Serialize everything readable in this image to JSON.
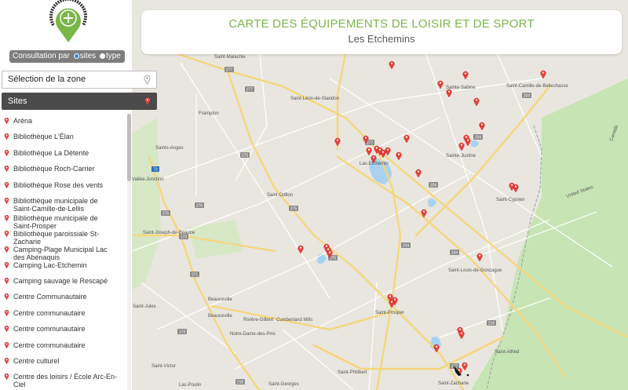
{
  "title": {
    "main": "CARTE DES ÉQUIPEMENTS DE LOISIR ET DE SPORT",
    "sub": "Les Etchemins"
  },
  "mode": {
    "label": "Consultation par",
    "option_sites": "sites",
    "option_type": "type",
    "selected": "sites"
  },
  "zone": {
    "placeholder": "Sélection de la zone"
  },
  "sites_header": "Sites",
  "sites": [
    {
      "label": "Aréna"
    },
    {
      "label": "Bibliothèque L'Élan"
    },
    {
      "label": "Bibliothèque La Détente"
    },
    {
      "label": "Bibliothèque Roch-Carrier"
    },
    {
      "label": "Bibliothèque Rose des vents"
    },
    {
      "label": "Bibliothèque municipale de Saint-Camille-de-Lellis"
    },
    {
      "label": "Bibliothèque municipale de Saint-Prosper"
    },
    {
      "label": "Bibliothèque paroissiale St-Zacharie"
    },
    {
      "label": "Camping-Plage Municipal Lac des Abénaquis"
    },
    {
      "label": "Camping Lac-Etchemin"
    },
    {
      "label": "Camping sauvage le Rescapé"
    },
    {
      "label": "Centre Communautaire"
    },
    {
      "label": "Centre communautaire"
    },
    {
      "label": "Centre communautaire"
    },
    {
      "label": "Centre communautaire"
    },
    {
      "label": "Centre culturel"
    },
    {
      "label": "Centre des loisirs / École Arc-En-Ciel"
    }
  ],
  "map": {
    "places": [
      {
        "name": "Saint-Malachie"
      },
      {
        "name": "Sainte-Sabine"
      },
      {
        "name": "Saint-Camille-de-Bellechasse"
      },
      {
        "name": "Saint-Léon-de-Standon"
      },
      {
        "name": "Frampton"
      },
      {
        "name": "Saints-Anges"
      },
      {
        "name": "Lac-Etchemin"
      },
      {
        "name": "Sainte-Justine"
      },
      {
        "name": "Saint-Odilon"
      },
      {
        "name": "Saint-Cyprien"
      },
      {
        "name": "Saint-Joseph-de-Beauce"
      },
      {
        "name": "Saint-Louis-de-Gonzague"
      },
      {
        "name": "Beauceville"
      },
      {
        "name": "Beauceville"
      },
      {
        "name": "Rivière-Gilbert"
      },
      {
        "name": "Saint-Prosper"
      },
      {
        "name": "Cumberland Mills"
      },
      {
        "name": "Notre-Dame-des-Pins"
      },
      {
        "name": "Saint-Victor"
      },
      {
        "name": "Saint-Philibert"
      },
      {
        "name": "Saint-Georges"
      },
      {
        "name": "Saint-Zacharie"
      },
      {
        "name": "Lac-Poulin"
      },
      {
        "name": "Canada"
      },
      {
        "name": "United States"
      },
      {
        "name": "Vallée-Jonction"
      },
      {
        "name": "Saint-Jules"
      },
      {
        "name": "Saint-Alfred"
      }
    ],
    "routes": [
      "277",
      "275",
      "276",
      "73",
      "204",
      "216",
      "173",
      "271",
      "275",
      "277",
      "204",
      "204",
      "277",
      "275",
      "276",
      "204",
      "277",
      "204",
      "216",
      "173"
    ],
    "marker_color": "#e8403a",
    "road_color": "#f5d77b",
    "land_color": "#e9e6df",
    "park_color": "#c7e4b5",
    "water_color": "#a9d2f1"
  }
}
